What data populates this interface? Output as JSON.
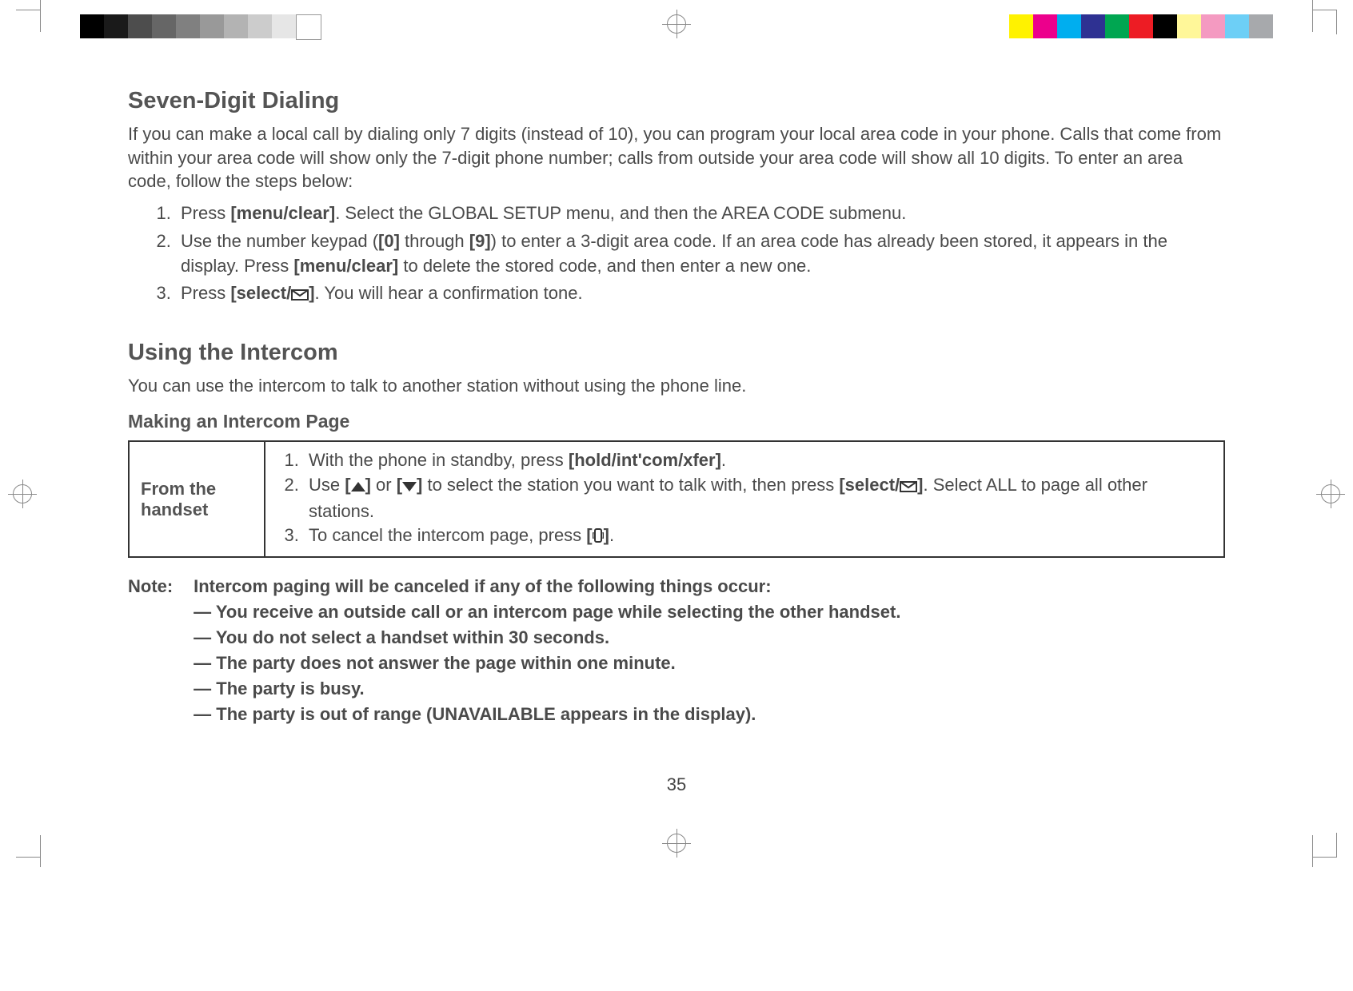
{
  "page_number": "35",
  "section1": {
    "title": "Seven-Digit Dialing",
    "intro": "If you can make a local call by dialing only 7 digits (instead of 10), you can program your local area code in your phone. Calls that come from within your area code will show only the 7-digit phone number; calls from outside your area code will show all 10 digits. To enter an area code, follow the steps below:",
    "steps": {
      "s1_a": "Press ",
      "s1_b": "[menu/clear]",
      "s1_c": ". Select the GLOBAL SETUP menu, and then the AREA CODE submenu.",
      "s2_a": "Use the number keypad (",
      "s2_b": "[0]",
      "s2_c": " through ",
      "s2_d": "[9]",
      "s2_e": ") to enter a 3-digit area code. If an area code has already been stored, it appears in the display. Press ",
      "s2_f": "[menu/clear]",
      "s2_g": "  to delete the stored code, and then enter a new one.",
      "s3_a": "Press ",
      "s3_b": "[select/",
      "s3_c": "]",
      "s3_d": ". You will hear a confirmation tone."
    }
  },
  "section2": {
    "title": "Using the Intercom",
    "intro": "You can use the intercom to talk to another station without using the phone line.",
    "sub": "Making an Intercom Page",
    "table": {
      "left": "From the handset",
      "s1_a": "With the phone in standby, press ",
      "s1_b": "[hold/int'com/xfer]",
      "s1_c": ".",
      "s2_a": "Use ",
      "s2_lb1": "[",
      "s2_rb1": "]",
      "s2_b": " or ",
      "s2_lb2": "[",
      "s2_rb2": "]",
      "s2_c": " to select the station you want to talk with, then press ",
      "s2_d": "[select/",
      "s2_e": "]",
      "s2_f": ". Select ALL to page all other stations.",
      "s3_a": "To cancel the intercom page, press ",
      "s3_b": "[",
      "s3_c": "]",
      "s3_d": "."
    },
    "note": {
      "label": "Note:",
      "head": "Intercom paging will be canceled if any of the following things occur:",
      "items": [
        "You receive an outside call or an intercom page while selecting the other handset.",
        "You do not select a handset within 30 seconds.",
        "The party does not answer the page within one minute.",
        "The party is busy.",
        "The party is out of range (UNAVAILABLE appears in the display)."
      ]
    }
  },
  "color_bars": {
    "left": [
      "#000000",
      "#1a1a1a",
      "#4d4d4d",
      "#666666",
      "#808080",
      "#999999",
      "#b3b3b3",
      "#cccccc",
      "#e6e6e6",
      "#ffffff"
    ],
    "right": [
      "#fff200",
      "#ec008c",
      "#00aeef",
      "#2e3192",
      "#00a651",
      "#ed1c24",
      "#000000",
      "#fff799",
      "#f49ac1",
      "#6dcff6",
      "#a7a9ac"
    ]
  }
}
